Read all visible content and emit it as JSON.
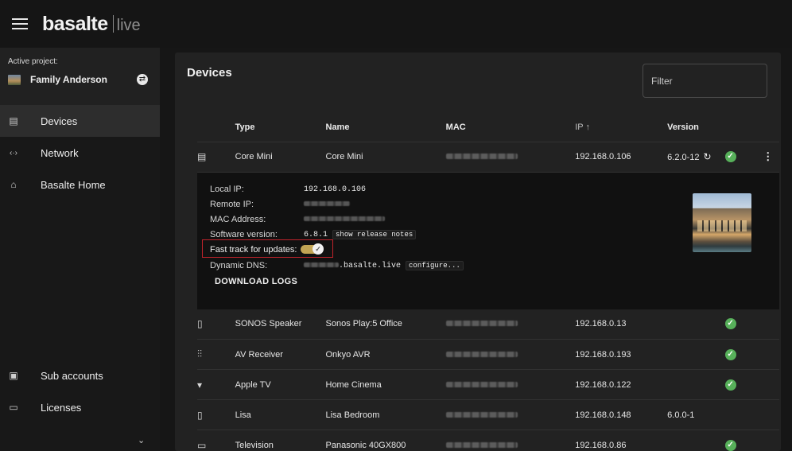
{
  "app": {
    "brand_name": "basalte",
    "brand_sub": "live"
  },
  "sidebar": {
    "project_label": "Active project:",
    "project_name": "Family Anderson",
    "items": [
      {
        "label": "Devices",
        "icon": "devices-icon"
      },
      {
        "label": "Network",
        "icon": "network-icon"
      },
      {
        "label": "Basalte Home",
        "icon": "home-icon"
      }
    ],
    "bottom_items": [
      {
        "label": "Sub accounts",
        "icon": "account-icon"
      },
      {
        "label": "Licenses",
        "icon": "license-icon"
      }
    ]
  },
  "main": {
    "title": "Devices",
    "filter_placeholder": "Filter",
    "columns": {
      "type": "Type",
      "name": "Name",
      "mac": "MAC",
      "ip": "IP ↑",
      "version": "Version"
    },
    "rows": [
      {
        "icon": "server-icon",
        "type": "Core Mini",
        "name": "Core Mini",
        "ip": "192.168.0.106",
        "version": "6.2.0-12",
        "status": "ok"
      },
      {
        "icon": "speaker-icon",
        "type": "SONOS Speaker",
        "name": "Sonos Play:5 Office",
        "ip": "192.168.0.13",
        "version": "",
        "status": "ok"
      },
      {
        "icon": "receiver-icon",
        "type": "AV Receiver",
        "name": "Onkyo AVR",
        "ip": "192.168.0.193",
        "version": "",
        "status": "ok"
      },
      {
        "icon": "appletv-icon",
        "type": "Apple TV",
        "name": "Home Cinema",
        "ip": "192.168.0.122",
        "version": "",
        "status": "ok"
      },
      {
        "icon": "tablet-icon",
        "type": "Lisa",
        "name": "Lisa Bedroom",
        "ip": "192.168.0.148",
        "version": "6.0.0-1",
        "status": ""
      },
      {
        "icon": "tv-icon",
        "type": "Television",
        "name": "Panasonic 40GX800",
        "ip": "192.168.0.86",
        "version": "",
        "status": "ok"
      }
    ],
    "detail": {
      "local_ip_label": "Local IP:",
      "local_ip_value": "192.168.0.106",
      "remote_ip_label": "Remote IP:",
      "mac_label": "MAC Address:",
      "software_label": "Software version:",
      "software_value": "6.8.1",
      "release_notes": "show release notes",
      "fast_track_label": "Fast track for updates:",
      "fast_track_on": true,
      "ddns_label": "Dynamic DNS:",
      "ddns_suffix": ".basalte.live",
      "configure": "configure...",
      "download_logs": "DOWNLOAD LOGS"
    }
  },
  "colors": {
    "status_ok": "#57b05a",
    "toggle_accent": "#c2a554",
    "highlight_red": "#c0232b"
  }
}
